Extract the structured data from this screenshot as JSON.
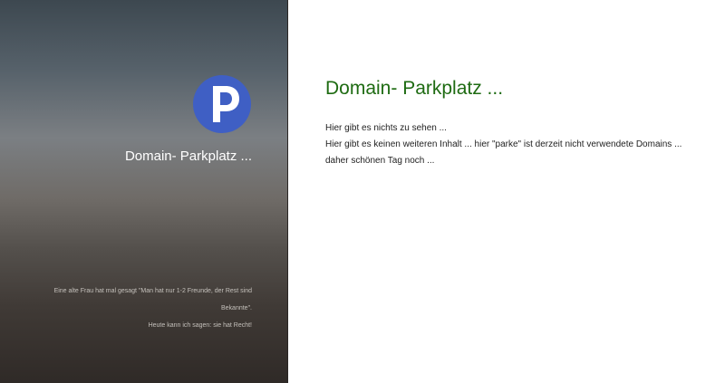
{
  "sidebar": {
    "logo_letter": "P",
    "title": "Domain- Parkplatz ...",
    "quote": {
      "line1": "Eine alte Frau hat mal gesagt \"Man hat nur 1-2 Freunde, der Rest sind Bekannte\".",
      "line2": "Heute kann ich sagen: sie hat Recht!"
    }
  },
  "main": {
    "title": "Domain- Parkplatz ...",
    "paragraph1": "Hier gibt es nichts zu sehen ...",
    "paragraph2": "Hier gibt es keinen weiteren Inhalt ... hier \"parke\" ist derzeit nicht verwendete Domains ... daher schönen Tag noch ..."
  },
  "colors": {
    "accent_green": "#1e6b12",
    "logo_blue": "#3f5fc4"
  },
  "icons": {
    "logo": "parking-p-icon"
  }
}
